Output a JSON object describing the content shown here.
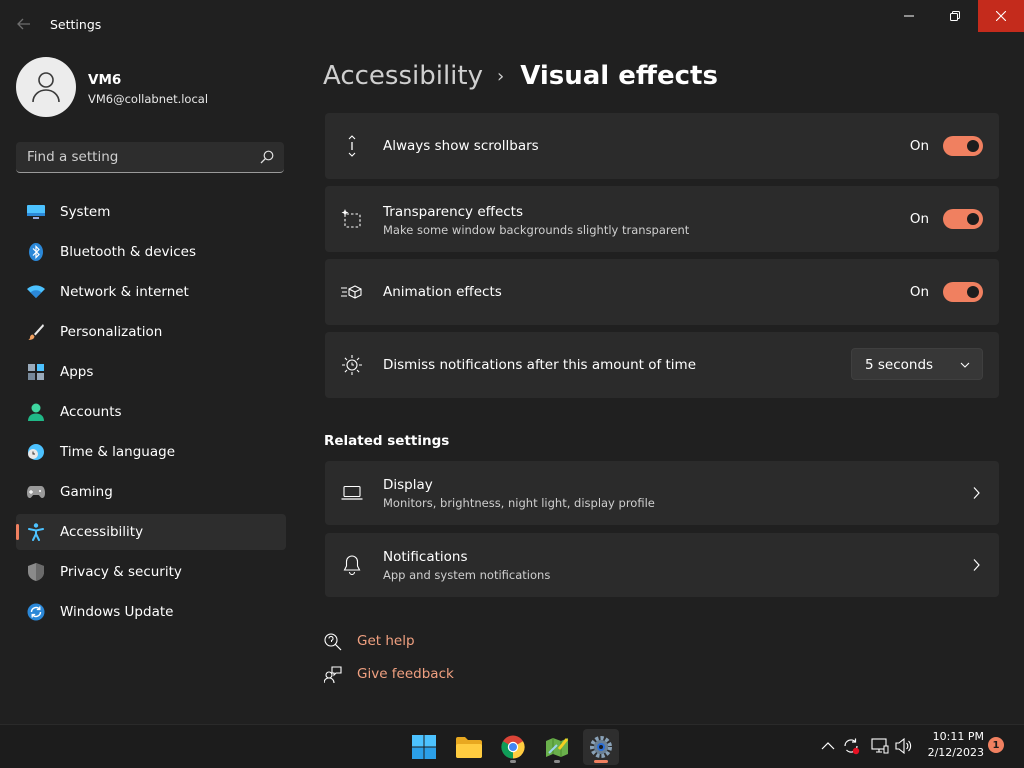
{
  "window": {
    "title": "Settings"
  },
  "profile": {
    "name": "VM6",
    "email": "VM6@collabnet.local"
  },
  "search": {
    "placeholder": "Find a setting"
  },
  "sidebar": {
    "items": [
      {
        "label": "System",
        "icon": "monitor-icon"
      },
      {
        "label": "Bluetooth & devices",
        "icon": "bluetooth-icon"
      },
      {
        "label": "Network & internet",
        "icon": "wifi-icon"
      },
      {
        "label": "Personalization",
        "icon": "brush-icon"
      },
      {
        "label": "Apps",
        "icon": "apps-icon"
      },
      {
        "label": "Accounts",
        "icon": "person-icon"
      },
      {
        "label": "Time & language",
        "icon": "clock-globe-icon"
      },
      {
        "label": "Gaming",
        "icon": "gamepad-icon"
      },
      {
        "label": "Accessibility",
        "icon": "accessibility-icon",
        "selected": true
      },
      {
        "label": "Privacy & security",
        "icon": "shield-icon"
      },
      {
        "label": "Windows Update",
        "icon": "update-icon"
      }
    ]
  },
  "breadcrumb": {
    "parent": "Accessibility",
    "separator": "›",
    "current": "Visual effects"
  },
  "settings": [
    {
      "title": "Always show scrollbars",
      "state": "On",
      "icon": "scrollbar-icon"
    },
    {
      "title": "Transparency effects",
      "description": "Make some window backgrounds slightly transparent",
      "state": "On",
      "icon": "transparency-icon"
    },
    {
      "title": "Animation effects",
      "state": "On",
      "icon": "animation-icon"
    },
    {
      "title": "Dismiss notifications after this amount of time",
      "value": "5 seconds",
      "icon": "sun-timer-icon"
    }
  ],
  "related": {
    "title": "Related settings",
    "items": [
      {
        "title": "Display",
        "description": "Monitors, brightness, night light, display profile",
        "icon": "laptop-icon"
      },
      {
        "title": "Notifications",
        "description": "App and system notifications",
        "icon": "bell-icon"
      }
    ]
  },
  "links": {
    "help": "Get help",
    "feedback": "Give feedback"
  },
  "taskbar": {
    "time": "10:11 PM",
    "date": "2/12/2023",
    "badge": "1"
  },
  "colors": {
    "accent": "#f08060",
    "background": "#202020",
    "card": "#2b2b2b",
    "close": "#c42b1c"
  }
}
